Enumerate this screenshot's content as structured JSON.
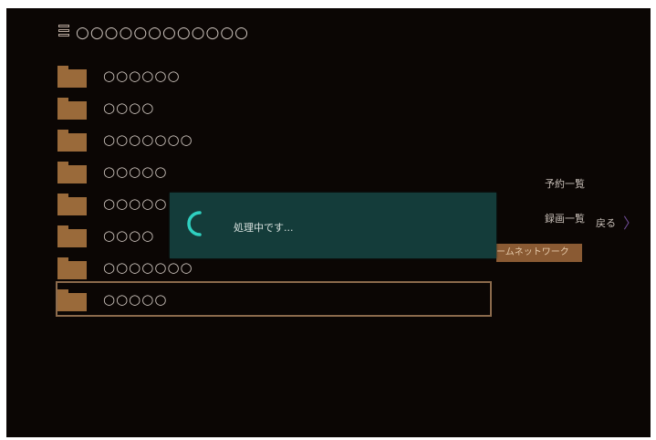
{
  "header": {
    "title": "○○○○○○○○○○○○",
    "icon": "server-icon"
  },
  "folders": [
    {
      "label": "○○○○○○",
      "icon": "folder-icon"
    },
    {
      "label": "○○○○",
      "icon": "folder-icon"
    },
    {
      "label": "○○○○○○○",
      "icon": "folder-icon"
    },
    {
      "label": "○○○○○",
      "icon": "folder-icon"
    },
    {
      "label": "○○○○○",
      "icon": "folder-icon"
    },
    {
      "label": "○○○○",
      "icon": "folder-icon"
    },
    {
      "label": "○○○○○○○",
      "icon": "folder-icon"
    },
    {
      "label": "○○○○○",
      "icon": "folder-icon",
      "selected": true
    }
  ],
  "side_menu": {
    "reservation_list": "予約一覧",
    "recording_list": "録画一覧",
    "back": "戻る",
    "home_network": "ームネットワーク"
  },
  "dialog": {
    "message": "処理中です..."
  },
  "colors": {
    "background": "#0b0604",
    "folder": "#9a6a3a",
    "dialog": "#143c3a",
    "spinner": "#2fd0c0",
    "selection_border": "#8b6a4c",
    "chevron": "#6c4a93"
  }
}
